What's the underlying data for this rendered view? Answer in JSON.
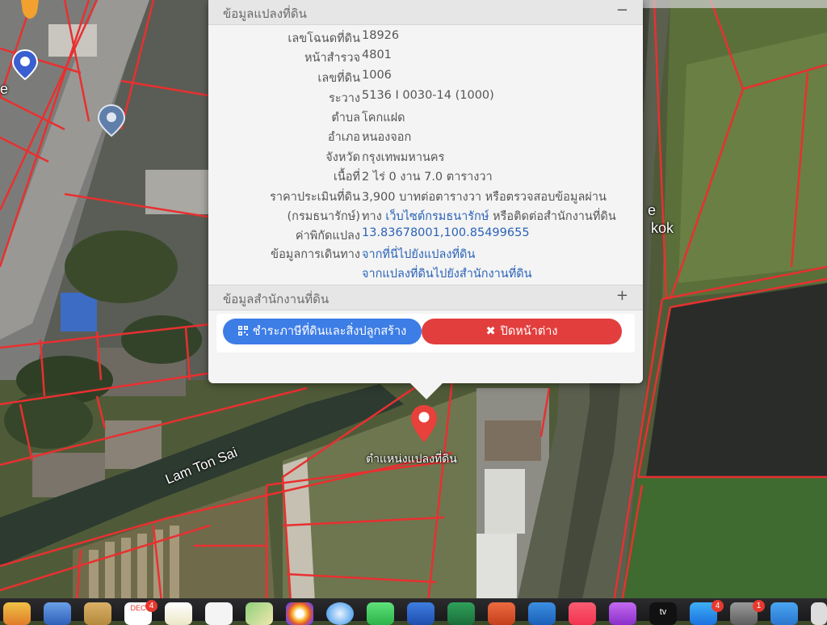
{
  "popup": {
    "title": "ข้อมูลแปลงที่ดิน",
    "collapse_symbol": "−",
    "fields": [
      {
        "label": "เลขโฉนดที่ดิน",
        "value": "18926"
      },
      {
        "label": "หน้าสำรวจ",
        "value": "4801"
      },
      {
        "label": "เลขที่ดิน",
        "value": "1006"
      },
      {
        "label": "ระวาง",
        "value": "5136 I 0030-14 (1000)"
      },
      {
        "label": "ตำบล",
        "value": "โคกแฝด"
      },
      {
        "label": "อำเภอ",
        "value": "หนองจอก"
      },
      {
        "label": "จังหวัด",
        "value": "กรุงเทพมหานคร"
      },
      {
        "label": "เนื้อที่",
        "value": "2 ไร่ 0 งาน 7.0 ตารางวา"
      },
      {
        "label": "ราคาประเมินที่ดิน",
        "value": "3,900 บาทต่อตารางวา หรือตรวจสอบข้อมูลผ่าน"
      },
      {
        "label": "(กรมธนารักษ์)",
        "value_plain": "ทาง",
        "value": "เว็บไซต์กรมธนารักษ์",
        "value_tail": "หรือติดต่อสำนักงานที่ดิน"
      },
      {
        "label": "ค่าพิกัดแปลง",
        "value": "13.83678001,100.85499655"
      },
      {
        "label": "ข้อมูลการเดินทาง",
        "value": "จากที่นี่ไปยังแปลงที่ดิน"
      },
      {
        "label": "",
        "value": "จากแปลงที่ดินไปยังสำนักงานที่ดิน"
      }
    ],
    "office_section": {
      "title": "ข้อมูลสำนักงานที่ดิน",
      "expand_symbol": "+"
    },
    "buttons": {
      "tax": {
        "label": "ชำระภาษีที่ดินและสิ่งปลูกสร้าง",
        "icon": "qr-code-icon",
        "color": "#3d7de6"
      },
      "close": {
        "label": "ปิดหน้าต่าง",
        "icon": "close-x-icon",
        "color": "#e23e3e"
      }
    }
  },
  "map": {
    "marker_label": "ตำแหน่งแปลงที่ดิน",
    "road_label": "Lam Ton Sai",
    "edge_label_1": "e",
    "edge_label_2": "kok",
    "edge_label_3": "e",
    "parcel_line_color": "#e83030"
  },
  "dock": {
    "calendar_month": "DEC",
    "calendar_badge": "4",
    "appstore_badge": "4",
    "settings_badge": "1",
    "tv_label": "tv"
  }
}
